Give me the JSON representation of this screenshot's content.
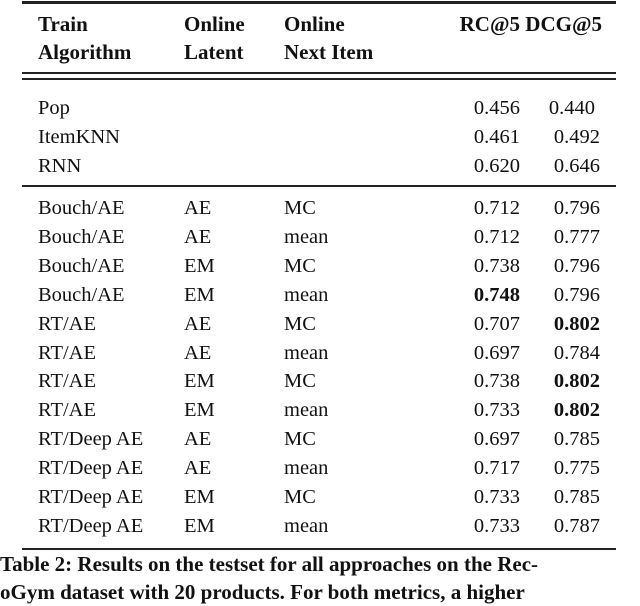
{
  "table": {
    "headers": [
      [
        "Train",
        "Algorithm"
      ],
      [
        "Online",
        "Latent"
      ],
      [
        "Online",
        "Next Item"
      ],
      [
        "RC@5",
        ""
      ],
      [
        "DCG@5",
        ""
      ]
    ],
    "baseline_rows": [
      {
        "algorithm": "Pop",
        "latent": "",
        "next_item": "",
        "rc5": "0.456",
        "dcg5": "0.440"
      },
      {
        "algorithm": "ItemKNN",
        "latent": "",
        "next_item": "",
        "rc5": "0.461",
        "dcg5": "0.492"
      },
      {
        "algorithm": "RNN",
        "latent": "",
        "next_item": "",
        "rc5": "0.620",
        "dcg5": "0.646"
      }
    ],
    "method_rows": [
      {
        "algorithm": "Bouch/AE",
        "latent": "AE",
        "next_item": "MC",
        "rc5": "0.712",
        "dcg5": "0.796"
      },
      {
        "algorithm": "Bouch/AE",
        "latent": "AE",
        "next_item": "mean",
        "rc5": "0.712",
        "dcg5": "0.777"
      },
      {
        "algorithm": "Bouch/AE",
        "latent": "EM",
        "next_item": "MC",
        "rc5": "0.738",
        "dcg5": "0.796"
      },
      {
        "algorithm": "Bouch/AE",
        "latent": "EM",
        "next_item": "mean",
        "rc5": "0.748",
        "dcg5": "0.796",
        "rc5_bold": true
      },
      {
        "algorithm": "RT/AE",
        "latent": "AE",
        "next_item": "MC",
        "rc5": "0.707",
        "dcg5": "0.802",
        "dcg5_bold": true
      },
      {
        "algorithm": "RT/AE",
        "latent": "AE",
        "next_item": "mean",
        "rc5": "0.697",
        "dcg5": "0.784"
      },
      {
        "algorithm": "RT/AE",
        "latent": "EM",
        "next_item": "MC",
        "rc5": "0.738",
        "dcg5": "0.802",
        "dcg5_bold": true
      },
      {
        "algorithm": "RT/AE",
        "latent": "EM",
        "next_item": "mean",
        "rc5": "0.733",
        "dcg5": "0.802",
        "dcg5_bold": true
      },
      {
        "algorithm": "RT/Deep AE",
        "latent": "AE",
        "next_item": "MC",
        "rc5": "0.697",
        "dcg5": "0.785"
      },
      {
        "algorithm": "RT/Deep AE",
        "latent": "AE",
        "next_item": "mean",
        "rc5": "0.717",
        "dcg5": "0.775"
      },
      {
        "algorithm": "RT/Deep AE",
        "latent": "EM",
        "next_item": "MC",
        "rc5": "0.733",
        "dcg5": "0.785"
      },
      {
        "algorithm": "RT/Deep AE",
        "latent": "EM",
        "next_item": "mean",
        "rc5": "0.733",
        "dcg5": "0.787"
      }
    ]
  },
  "caption": {
    "lines": [
      "Table 2: Results on the testset for all approaches on the Rec-",
      "oGym dataset with 20 products. For both metrics, a higher"
    ]
  }
}
